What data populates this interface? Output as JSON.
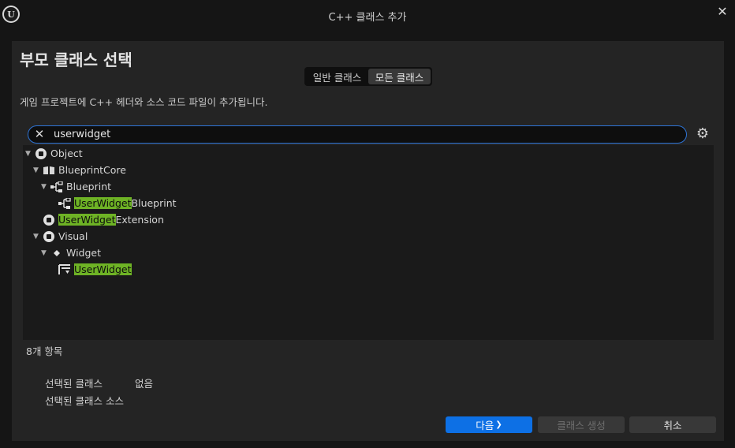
{
  "window": {
    "logo_letter": "U",
    "title": "C++ 클래스 추가",
    "close_glyph": "✕"
  },
  "header": {
    "title": "부모 클래스 선택"
  },
  "tabs": [
    {
      "label": "일반 클래스",
      "active": false
    },
    {
      "label": "모든 클래스",
      "active": true
    }
  ],
  "description": "게임 프로젝트에 C++ 헤더와 소스 코드 파일이 추가됩니다.",
  "search": {
    "value": "userwidget",
    "clear_glyph": "✕",
    "settings_glyph": "⚙"
  },
  "tree": [
    {
      "pre": "Object",
      "match": "",
      "post": "",
      "expanded": true,
      "icon": "class-circle-icon"
    },
    {
      "pre": "BlueprintCore",
      "match": "",
      "post": "",
      "expanded": true,
      "icon": "book-icon"
    },
    {
      "pre": "Blueprint",
      "match": "",
      "post": "",
      "expanded": true,
      "icon": "blueprint-node-icon"
    },
    {
      "pre": "",
      "match": "UserWidget",
      "post": "Blueprint",
      "expanded": null,
      "icon": "blueprint-node-icon"
    },
    {
      "pre": "",
      "match": "UserWidget",
      "post": "Extension",
      "expanded": null,
      "icon": "class-circle-icon"
    },
    {
      "pre": "Visual",
      "match": "",
      "post": "",
      "expanded": true,
      "icon": "class-circle-icon"
    },
    {
      "pre": "Widget",
      "match": "",
      "post": "",
      "expanded": true,
      "icon": "diamond-dot-icon"
    },
    {
      "pre": "",
      "match": "UserWidget",
      "post": "",
      "expanded": null,
      "icon": "user-widget-icon"
    }
  ],
  "item_count": "8개 항목",
  "info": {
    "selected_class_label": "선택된 클래스",
    "selected_class_value": "없음",
    "selected_source_label": "선택된 클래스 소스"
  },
  "buttons": {
    "next": "다음",
    "next_glyph": "❯",
    "create": "클래스 생성",
    "cancel": "취소"
  },
  "colors": {
    "accent": "#0d70e5",
    "search_border": "#2e74d6",
    "highlight": "#6eb325"
  }
}
